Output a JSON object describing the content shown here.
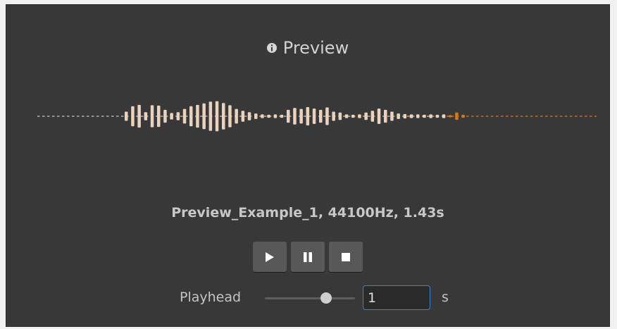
{
  "header": {
    "icon": "info-icon",
    "title": "Preview"
  },
  "waveform": {
    "played_color": "#e9d3bf",
    "unplayed_color": "#d07a1c",
    "played_fraction": 0.73
  },
  "clip": {
    "info": "Preview_Example_1, 44100Hz, 1.43s"
  },
  "controls": {
    "play_icon": "play-icon",
    "pause_icon": "pause-icon",
    "stop_icon": "stop-icon"
  },
  "playhead": {
    "label": "Playhead",
    "slider_fraction": 0.68,
    "value": "1",
    "unit": "s"
  },
  "colors": {
    "panel_bg": "#383838",
    "button_bg": "#585858",
    "focus_border": "#3d83cc"
  }
}
